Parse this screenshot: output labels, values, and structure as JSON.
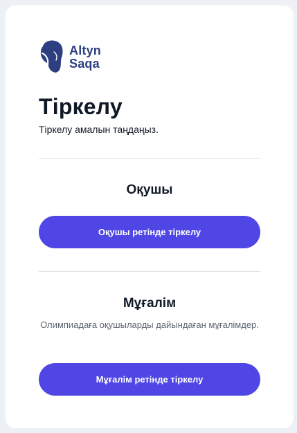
{
  "brand": {
    "name_line1": "Altyn",
    "name_line2": "Saqa",
    "color": "#2d3f80",
    "logo_icon": "girl-silhouette-logo-icon"
  },
  "page": {
    "title": "Тіркелу",
    "subtitle": "Тіркелу амалын таңдаңыз."
  },
  "roles": {
    "student": {
      "title": "Оқушы",
      "button_label": "Оқушы ретінде тіркелу"
    },
    "teacher": {
      "title": "Мұғалім",
      "description": "Олимпиадаға оқушыларды дайындаған мұғалімдер.",
      "button_label": "Мұғалім ретінде тіркелу"
    }
  },
  "colors": {
    "accent": "#4f46e5",
    "background": "#edf0f5",
    "card": "#ffffff"
  }
}
